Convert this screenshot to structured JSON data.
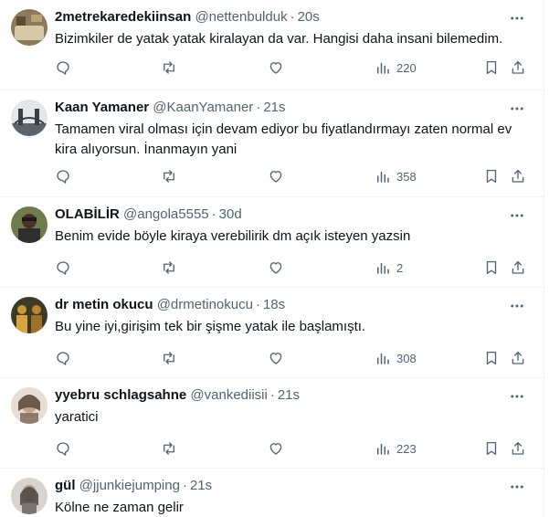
{
  "tweets": [
    {
      "name": "2metrekaredekiinsan",
      "handle": "@nettenbulduk",
      "time": "20s",
      "text": "Bizimkiler de yatak yatak kiralayan da var. Hangisi daha insani bilemedim.",
      "views": "220",
      "avatar_colors": [
        "#7a6a4f",
        "#c9b58f"
      ]
    },
    {
      "name": "Kaan Yamaner",
      "handle": "@KaanYamaner",
      "time": "21s",
      "text": "Tamamen viral olması için devam ediyor bu fiyatlandırmayı zaten normal ev kira alıyorsun. İnanmayın yani",
      "views": "358",
      "avatar_colors": [
        "#d7dbe0",
        "#3a3f45"
      ]
    },
    {
      "name": "OLABİLİR",
      "handle": "@angola5555",
      "time": "30d",
      "text": "Benim evide böyle kiraya verebilirik dm açık isteyen yazsin",
      "views": "2",
      "avatar_colors": [
        "#5a6b3a",
        "#2b2b2b"
      ]
    },
    {
      "name": "dr metin okucu",
      "handle": "@drmetinokucu",
      "time": "18s",
      "text": "Bu yine iyi,girişim tek bir şişme yatak ile başlamıştı.",
      "views": "308",
      "avatar_colors": [
        "#b8862f",
        "#3d3a28"
      ]
    },
    {
      "name": "yyebru schlagsahne",
      "handle": "@vankediisii",
      "time": "21s",
      "text": "yaratici",
      "views": "223",
      "avatar_colors": [
        "#d9c6b8",
        "#6b5a4e"
      ]
    },
    {
      "name": "gül",
      "handle": "@jjunkiejumping",
      "time": "21s",
      "text": "Kölne ne zaman gelir",
      "views": "",
      "avatar_colors": [
        "#cfc8c2",
        "#4a4440"
      ]
    }
  ],
  "separator": "·",
  "icons": {
    "reply": "reply-icon",
    "retweet": "retweet-icon",
    "like": "like-icon",
    "views": "views-icon",
    "bookmark": "bookmark-icon",
    "share": "share-icon",
    "more": "more-icon"
  },
  "colors": {
    "text": "#0f1419",
    "secondary": "#536471",
    "border": "#eff3f4"
  }
}
